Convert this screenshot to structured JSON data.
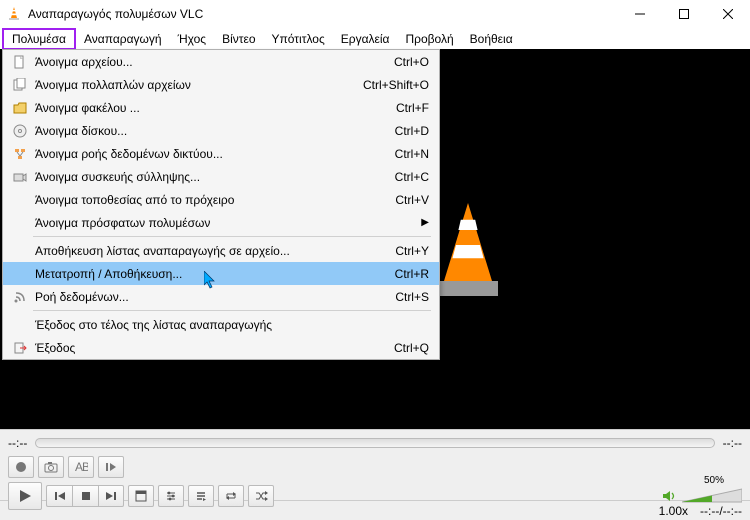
{
  "window": {
    "title": "Αναπαραγωγός πολυμέσων VLC"
  },
  "menubar": {
    "items": [
      {
        "label": "Πολυμέσα",
        "active": true
      },
      {
        "label": "Αναπαραγωγή"
      },
      {
        "label": "Ήχος"
      },
      {
        "label": "Βίντεο"
      },
      {
        "label": "Υπότιτλος"
      },
      {
        "label": "Εργαλεία"
      },
      {
        "label": "Προβολή"
      },
      {
        "label": "Βοήθεια"
      }
    ]
  },
  "dropdown": {
    "rows": [
      {
        "icon": "file-icon",
        "label": "Άνοιγμα αρχείου...",
        "shortcut": "Ctrl+O"
      },
      {
        "icon": "files-icon",
        "label": "Άνοιγμα πολλαπλών αρχείων",
        "shortcut": "Ctrl+Shift+O"
      },
      {
        "icon": "folder-icon",
        "label": "Άνοιγμα φακέλου ...",
        "shortcut": "Ctrl+F"
      },
      {
        "icon": "disc-icon",
        "label": "Άνοιγμα δίσκου...",
        "shortcut": "Ctrl+D"
      },
      {
        "icon": "network-icon",
        "label": "Άνοιγμα ροής δεδομένων δικτύου...",
        "shortcut": "Ctrl+N"
      },
      {
        "icon": "capture-icon",
        "label": "Άνοιγμα συσκευής σύλληψης...",
        "shortcut": "Ctrl+C"
      },
      {
        "icon": "",
        "label": "Άνοιγμα τοποθεσίας από το πρόχειρο",
        "shortcut": "Ctrl+V"
      },
      {
        "icon": "",
        "label": "Άνοιγμα πρόσφατων πολυμέσων",
        "shortcut": "",
        "submenu": true
      },
      {
        "sep": true
      },
      {
        "icon": "",
        "label": "Αποθήκευση λίστας αναπαραγωγής σε αρχείο...",
        "shortcut": "Ctrl+Y"
      },
      {
        "icon": "",
        "label": "Μετατροπή / Αποθήκευση...",
        "shortcut": "Ctrl+R",
        "highlighted": true
      },
      {
        "icon": "stream-icon",
        "label": "Ροή δεδομένων...",
        "shortcut": "Ctrl+S"
      },
      {
        "sep": true
      },
      {
        "icon": "",
        "label": "Έξοδος στο τέλος της λίστας αναπαραγωγής",
        "shortcut": ""
      },
      {
        "icon": "exit-icon",
        "label": "Έξοδος",
        "shortcut": "Ctrl+Q"
      }
    ]
  },
  "player": {
    "time_current": "--:--",
    "time_total": "--:--",
    "volume_pct": "50%",
    "speed": "1.00x",
    "status_time": "--:--/--:--"
  },
  "colors": {
    "accent": "#ff8800",
    "highlight": "#91c9f7",
    "active_border": "#a020f0"
  }
}
